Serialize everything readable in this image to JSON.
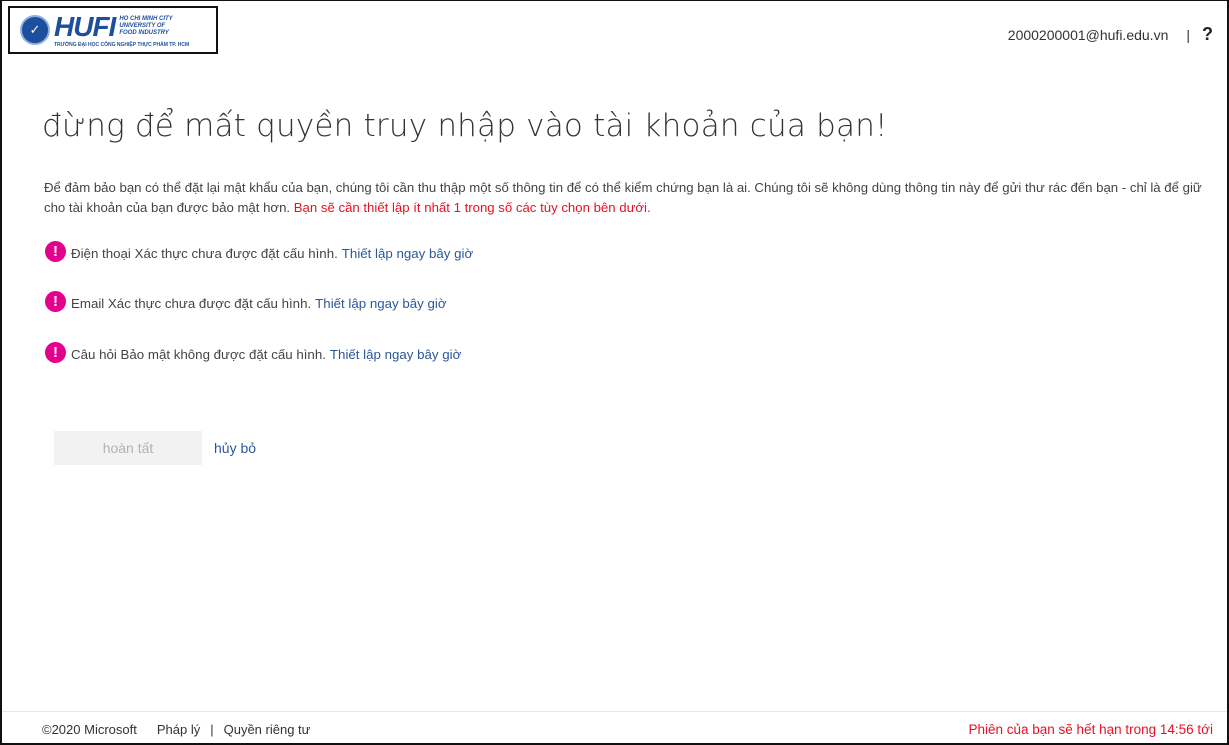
{
  "header": {
    "logo": {
      "brand": "HUFI",
      "seal_text": "✓",
      "sub_line1": "HO CHI MINH CITY",
      "sub_line2": "UNIVERSITY OF",
      "sub_line3": "FOOD INDUSTRY",
      "bottom_line": "TRƯỜNG ĐẠI HỌC CÔNG NGHIỆP THỰC PHẨM TP. HCM"
    },
    "user_email": "2000200001@hufi.edu.vn",
    "separator": "|",
    "help_label": "?"
  },
  "main": {
    "heading": "đừng để mất quyền truy nhập vào tài khoản của bạn!",
    "description": "Để đảm bảo bạn có thể đặt lại mật khẩu của bạn, chúng tôi cần thu thập một số thông tin để có thể kiểm chứng bạn là ai. Chúng tôi sẽ không dùng thông tin này để gửi thư rác đến bạn - chỉ là để giữ cho tài khoản của bạn được bảo mật hơn.",
    "description_warning": "Bạn sẽ cần thiết lập ít nhất 1 trong số các tùy chọn bên dưới.",
    "items": [
      {
        "icon": "!",
        "text": "Điện thoại Xác thực chưa được đặt cấu hình.",
        "link": "Thiết lập ngay bây giờ"
      },
      {
        "icon": "!",
        "text": "Email Xác thực chưa được đặt cấu hình.",
        "link": "Thiết lập ngay bây giờ"
      },
      {
        "icon": "!",
        "text": "Câu hỏi Bảo mật không được đặt cấu hình.",
        "link": "Thiết lập ngay bây giờ"
      }
    ],
    "finish_label": "hoàn tất",
    "cancel_label": "hủy bỏ"
  },
  "footer": {
    "copyright": "©2020 Microsoft",
    "legal": "Pháp lý",
    "separator": "|",
    "privacy": "Quyền riêng tư",
    "session_notice": "Phiên của bạn sẽ hết hạn trong 14:56 tới"
  },
  "colors": {
    "link": "#2b579a",
    "warning": "#e81123",
    "alert_icon": "#e3008c",
    "logo_blue": "#1d4f9e"
  }
}
